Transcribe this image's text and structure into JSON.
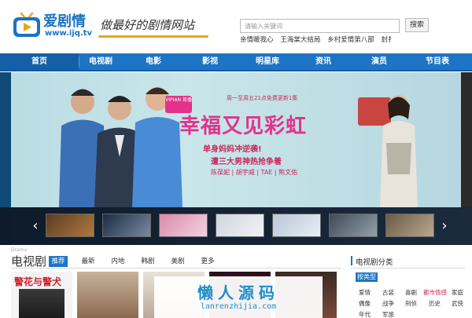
{
  "header": {
    "site_name": "爱剧情",
    "domain": "www.ijq.tv",
    "slogan": "做最好的剧情网站"
  },
  "search": {
    "placeholder": "请输入关键词",
    "button_label": "搜索",
    "hot_links": [
      "亲情暖我心",
      "王海棠大结局",
      "乡村爱情第八部",
      "封扌"
    ]
  },
  "nav": {
    "items": [
      "首页",
      "电视剧",
      "电影",
      "影视",
      "明星库",
      "资讯",
      "演员",
      "节目表"
    ],
    "active_index": 0
  },
  "banner": {
    "badge": "VIPIAN 首播",
    "schedule": "周一至周五21点免费更新1集",
    "headline": "幸福又见彩虹",
    "tagline1": "单身妈妈冲逆袭!",
    "tagline2": "遭三大男神热抢争着",
    "cast": "陈葆妮 | 胡宇威 | TAE | 熊文佑"
  },
  "section": {
    "sub": "Drama",
    "title": "电视剧",
    "tabs": [
      "推荐",
      "最新",
      "内地",
      "韩剧",
      "美剧",
      "更多"
    ],
    "active_tab": 0
  },
  "sidebar": {
    "title": "电视剧分类",
    "type_label": "按类型",
    "genres": [
      [
        "爱情",
        "古装",
        "喜剧",
        "都市情感",
        "家庭"
      ],
      [
        "偶像",
        "战争",
        "刑侦",
        "历史",
        "武侠"
      ],
      [
        "年代",
        "军旅"
      ]
    ],
    "highlight": "都市情感"
  },
  "watermark": {
    "cn": "懒人源码",
    "en": "lanrenzhijia.com"
  },
  "poster_text": "警花与警犬",
  "colors": {
    "brand_blue": "#1e74c4",
    "accent_pink": "#e2338a",
    "slogan_underline": "#e8a51c"
  }
}
